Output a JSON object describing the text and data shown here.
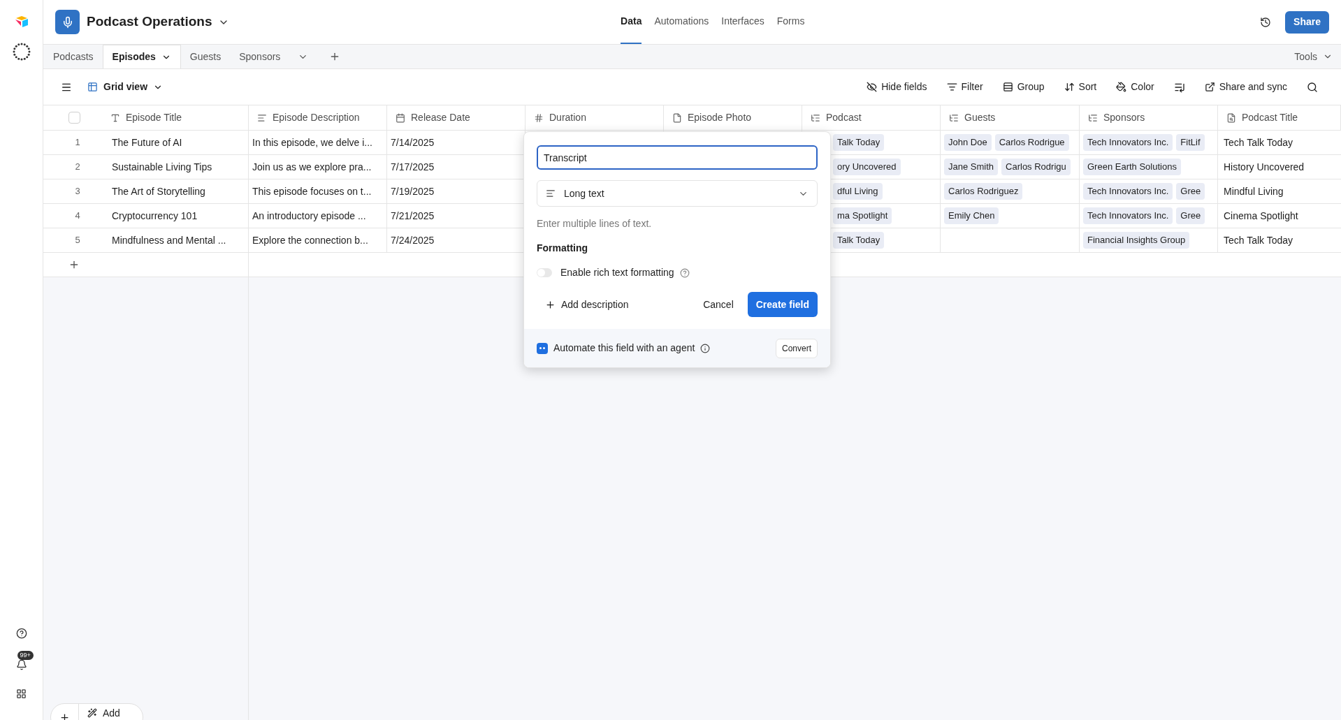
{
  "sidebar": {
    "notification_badge": "99+"
  },
  "header": {
    "base_name": "Podcast Operations",
    "nav": [
      {
        "label": "Data",
        "selected": true
      },
      {
        "label": "Automations",
        "selected": false
      },
      {
        "label": "Interfaces",
        "selected": false
      },
      {
        "label": "Forms",
        "selected": false
      }
    ],
    "share_button": "Share"
  },
  "tables": [
    {
      "label": "Podcasts",
      "selected": false
    },
    {
      "label": "Episodes",
      "selected": true
    },
    {
      "label": "Guests",
      "selected": false
    },
    {
      "label": "Sponsors",
      "selected": false
    }
  ],
  "tools": "Tools",
  "toolbar": {
    "view": "Grid view",
    "actions": [
      {
        "kind": "hide",
        "label": "Hide fields"
      },
      {
        "kind": "filter",
        "label": "Filter"
      },
      {
        "kind": "group",
        "label": "Group"
      },
      {
        "kind": "sort",
        "label": "Sort"
      },
      {
        "kind": "color",
        "label": "Color"
      },
      {
        "kind": "share",
        "label": "Share and sync"
      }
    ]
  },
  "grid": {
    "select_all": {
      "checked": false
    },
    "columns": [
      {
        "label": "Episode Title",
        "kind": "text"
      },
      {
        "label": "Episode Description",
        "kind": "long_text"
      },
      {
        "label": "Release Date",
        "kind": "date"
      },
      {
        "label": "Duration",
        "kind": "number"
      },
      {
        "label": "Episode Photo",
        "kind": "attachment"
      },
      {
        "label": "Podcast",
        "kind": "link"
      },
      {
        "label": "Guests",
        "kind": "link"
      },
      {
        "label": "Sponsors",
        "kind": "link"
      },
      {
        "label": "Podcast Title",
        "kind": "lookup"
      }
    ],
    "rows": [
      {
        "number": "1",
        "title": "The Future of AI",
        "description": "In this episode, we delve i...",
        "release_date": "7/14/2025",
        "podcast": "Talk Today",
        "guests": [
          "John Doe",
          "Carlos Rodrigue"
        ],
        "sponsors": [
          "Tech Innovators Inc.",
          "FitLif"
        ],
        "podcast_title": "Tech Talk Today"
      },
      {
        "number": "2",
        "title": "Sustainable Living Tips",
        "description": "Join us as we explore pra...",
        "release_date": "7/17/2025",
        "podcast": "ory Uncovered",
        "guests": [
          "Jane Smith",
          "Carlos Rodrigu"
        ],
        "sponsors": [
          "Green Earth Solutions"
        ],
        "podcast_title": "History Uncovered"
      },
      {
        "number": "3",
        "title": "The Art of Storytelling",
        "description": "This episode focuses on t...",
        "release_date": "7/19/2025",
        "podcast": "dful Living",
        "guests": [
          "Carlos Rodriguez"
        ],
        "sponsors": [
          "Tech Innovators Inc.",
          "Gree"
        ],
        "podcast_title": "Mindful Living"
      },
      {
        "number": "4",
        "title": "Cryptocurrency 101",
        "description": "An introductory episode ...",
        "release_date": "7/21/2025",
        "podcast": "ma Spotlight",
        "guests": [
          "Emily Chen"
        ],
        "sponsors": [
          "Tech Innovators Inc.",
          "Gree"
        ],
        "podcast_title": "Cinema Spotlight"
      },
      {
        "number": "5",
        "title": "Mindfulness and Mental ...",
        "description": "Explore the connection b...",
        "release_date": "7/24/2025",
        "podcast": "Talk Today",
        "guests": [],
        "sponsors": [
          "Financial Insights Group"
        ],
        "podcast_title": "Tech Talk Today"
      }
    ]
  },
  "field_popup": {
    "name_value": "Transcript",
    "type": "Long text",
    "hint": "Enter multiple lines of text.",
    "formatting_heading": "Formatting",
    "rich_text": {
      "label": "Enable rich text formatting",
      "on": false
    },
    "add_description": "Add description",
    "cancel": "Cancel",
    "create": "Create field",
    "agent": {
      "label": "Automate this field with an agent",
      "checked": true
    },
    "convert": "Convert"
  },
  "add_bar": {
    "label": "Add"
  }
}
